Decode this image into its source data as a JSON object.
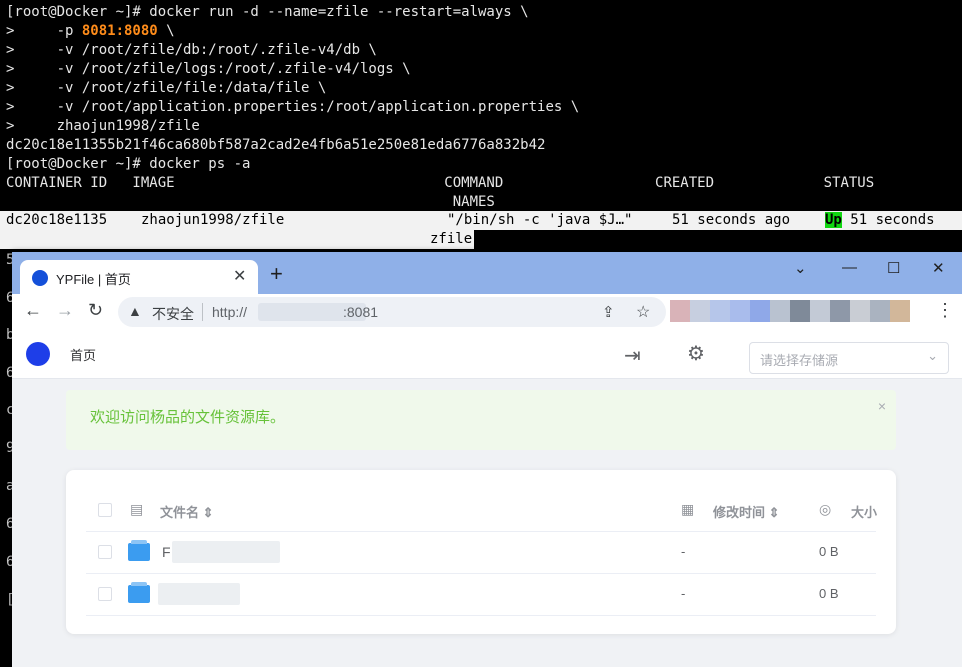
{
  "terminal": {
    "lines": [
      "[root@Docker ~]# docker run -d --name=zfile --restart=always \\",
      ">     -p ",
      ">     -v /root/zfile/db:/root/.zfile-v4/db \\",
      ">     -v /root/zfile/logs:/root/.zfile-v4/logs \\",
      ">     -v /root/zfile/file:/data/file \\",
      ">     -v /root/application.properties:/root/application.properties \\",
      ">     zhaojun1998/zfile",
      "dc20c18e11355b21f46ca680bf587a2cad2e4fb6a51e250e81eda6776a832b42",
      "[root@Docker ~]# docker ps -a",
      "CONTAINER ID   IMAGE                                COMMAND                  CREATED             STATUS",
      "                                                     NAMES"
    ],
    "port_highlight": "8081:8080",
    "port_tail": " \\",
    "row": {
      "id": "dc20c18e1135",
      "image": "zhaojun1998/zfile",
      "command": "\"/bin/sh -c 'java $J…\"",
      "created": "51 seconds ago",
      "status_up": "Up",
      "status_rest": " 51 seconds",
      "name": "zfile"
    },
    "gutter_chars": [
      "5",
      "6",
      "b",
      "6",
      "c",
      "9",
      "a",
      "6",
      "6",
      "["
    ]
  },
  "browser": {
    "tab_title": "YPFile | 首页",
    "tab_close": "✕",
    "new_tab": "+",
    "win_min": "⌄",
    "win_dash": "—",
    "win_max": "☐",
    "win_close": "✕",
    "nav_back": "←",
    "nav_forward": "→",
    "nav_reload": "↻",
    "security_warning": "▲",
    "insecure_label": "不安全",
    "url_scheme": "http://",
    "url_port": ":8081",
    "share_icon": "⇪",
    "star_icon": "☆",
    "menu_icon": "⋮",
    "ext_colors": [
      "#d9b3b8",
      "#c7cfe0",
      "#b6c6ea",
      "#a9bcec",
      "#8fa8e8",
      "#b9c2d0",
      "#7f8a99",
      "#c3cad6",
      "#8e98a8",
      "#c9cdd4",
      "#aab3c0",
      "#d2b79a"
    ]
  },
  "app": {
    "home": "首页",
    "login_icon": "⇥",
    "gear_icon": "⚙",
    "select_placeholder": "请选择存储源",
    "select_arrow": "⌄",
    "alert_text": "欢迎访问杨品的文件资源库。",
    "alert_close": "×",
    "table": {
      "col_name": "文件名",
      "col_modified": "修改时间",
      "col_size": "大小",
      "sort_icon": "⇕",
      "doc_icon": "▤",
      "cal_icon": "▦",
      "db_icon": "◎",
      "rows": [
        {
          "name": "F",
          "modified": "-",
          "size": "0 B"
        },
        {
          "name": "",
          "modified": "-",
          "size": "0 B"
        }
      ]
    }
  },
  "colors": {
    "accent": "#1e3ee8",
    "alert_bg": "#f0f9eb",
    "alert_text": "#67c23a",
    "status_up": "#11d611",
    "port_orange": "#ff8c1a",
    "tabbar": "#8fb0e8"
  }
}
